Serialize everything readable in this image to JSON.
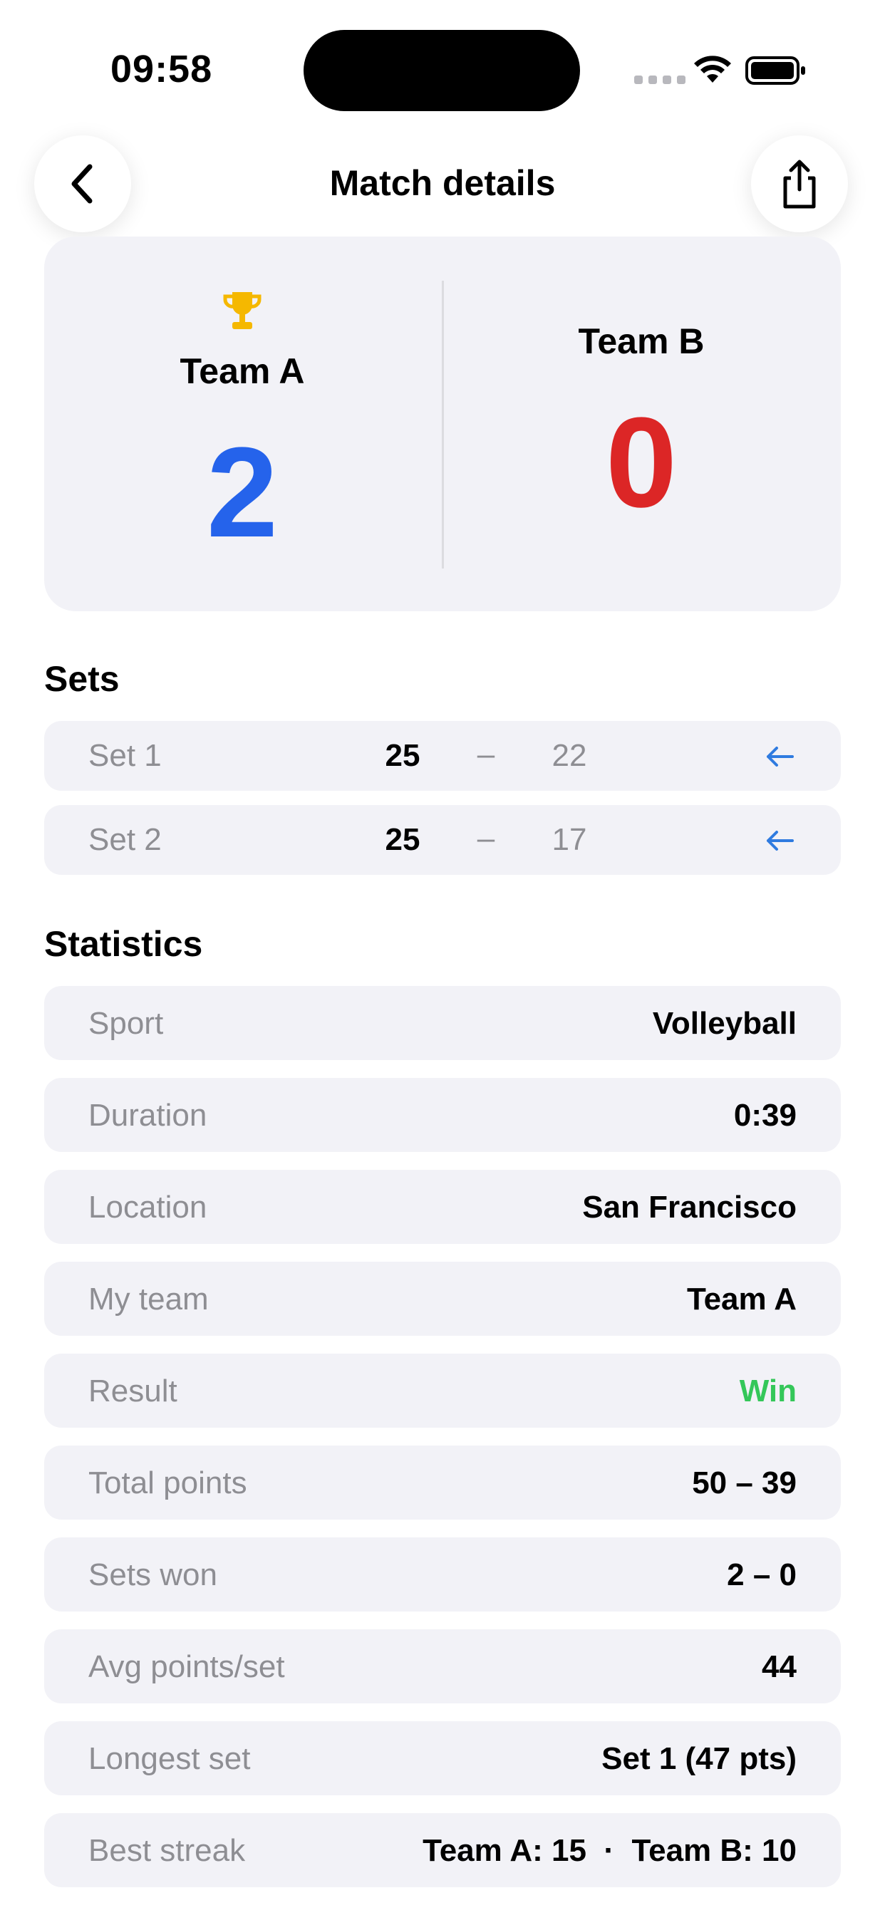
{
  "status_bar": {
    "time": "09:58"
  },
  "nav": {
    "title": "Match details"
  },
  "score_card": {
    "team_a": {
      "name": "Team A",
      "score": "2"
    },
    "team_b": {
      "name": "Team B",
      "score": "0"
    }
  },
  "sets": {
    "title": "Sets",
    "rows": [
      {
        "label": "Set 1",
        "a": "25",
        "dash": "–",
        "b": "22"
      },
      {
        "label": "Set 2",
        "a": "25",
        "dash": "–",
        "b": "17"
      }
    ]
  },
  "statistics": {
    "title": "Statistics",
    "rows": [
      {
        "label": "Sport",
        "value": "Volleyball"
      },
      {
        "label": "Duration",
        "value": "0:39"
      },
      {
        "label": "Location",
        "value": "San Francisco"
      },
      {
        "label": "My team",
        "value": "Team A"
      },
      {
        "label": "Result",
        "value": "Win"
      },
      {
        "label": "Total points",
        "value": "50 – 39"
      },
      {
        "label": "Sets won",
        "value": "2 – 0"
      },
      {
        "label": "Avg points/set",
        "value": "44"
      },
      {
        "label": "Longest set",
        "value": "Set 1 (47 pts)"
      },
      {
        "label": "Best streak",
        "value": "Team A: 15  ·  Team B: 10"
      }
    ]
  },
  "colors": {
    "team_a": "#2563eb",
    "team_b": "#dc2626",
    "win": "#34c759",
    "card_bg": "#f2f2f7",
    "trophy": "#f5b800",
    "arrow": "#2f7be0"
  },
  "icons": {
    "back": "chevron-left-icon",
    "share": "share-icon",
    "trophy": "trophy-icon",
    "set_winner": "arrow-left-icon"
  }
}
